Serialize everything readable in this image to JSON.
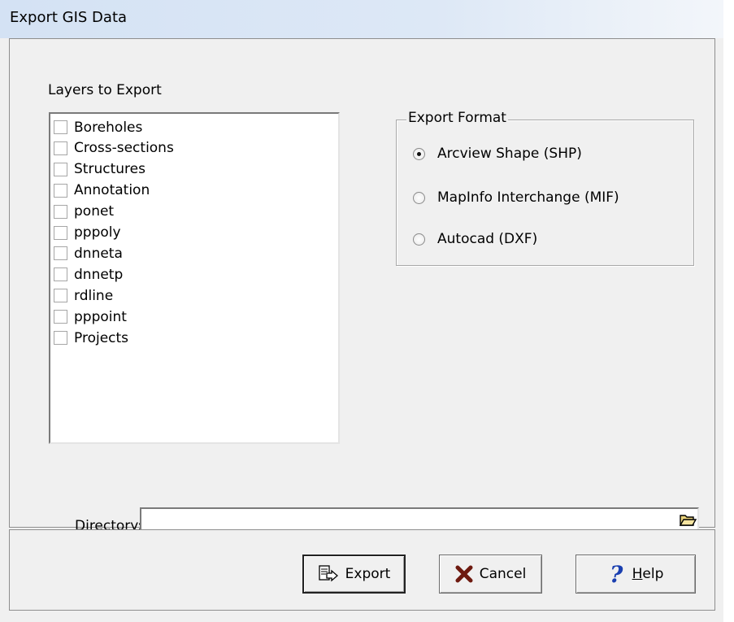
{
  "window": {
    "title": "Export GIS Data"
  },
  "layers": {
    "label": "Layers to Export",
    "items": [
      {
        "label": "Boreholes",
        "checked": false
      },
      {
        "label": "Cross-sections",
        "checked": false
      },
      {
        "label": "Structures",
        "checked": false
      },
      {
        "label": "Annotation",
        "checked": false
      },
      {
        "label": "ponet",
        "checked": false
      },
      {
        "label": "pppoly",
        "checked": false
      },
      {
        "label": "dnneta",
        "checked": false
      },
      {
        "label": "dnnetp",
        "checked": false
      },
      {
        "label": "rdline",
        "checked": false
      },
      {
        "label": "pppoint",
        "checked": false
      },
      {
        "label": "Projects",
        "checked": false
      }
    ]
  },
  "export_format": {
    "label": "Export Format",
    "options": [
      {
        "label": "Arcview Shape (SHP)",
        "selected": true
      },
      {
        "label": "MapInfo Interchange (MIF)",
        "selected": false
      },
      {
        "label": "Autocad (DXF)",
        "selected": false
      }
    ]
  },
  "directory": {
    "label": "Directory:",
    "value": "",
    "browse_icon": "folder-open-icon"
  },
  "buttons": {
    "export": {
      "label": "Export",
      "icon": "export-icon"
    },
    "cancel": {
      "label": "Cancel",
      "icon": "x-icon",
      "icon_color": "#7a1a10"
    },
    "help": {
      "label_mnemonic": "H",
      "label_rest": "elp",
      "icon": "question-mark-icon",
      "icon_color": "#1a3fb0"
    }
  }
}
